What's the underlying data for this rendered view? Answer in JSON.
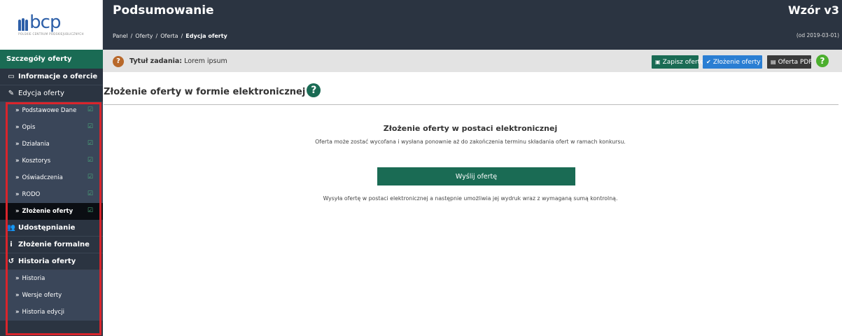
{
  "logo": {
    "word": "bcp",
    "sub": "POLSKIE CENTRUM PODSKIEJUBLICZNYCH"
  },
  "header": {
    "title": "Podsumowanie",
    "breadcrumb": [
      "Panel",
      "Oferty",
      "Oferta",
      "Edycja oferty"
    ],
    "template_title": "Wzór v3",
    "template_date": "(od 2019-03-01)"
  },
  "sidebar": {
    "heading": "Szczegóły oferty",
    "items": [
      {
        "label": "Informacje o ofercie",
        "icon": "monitor-icon"
      },
      {
        "label": "Edycja oferty",
        "icon": "pencil-icon"
      }
    ],
    "sub_items": [
      {
        "label": "Podstawowe Dane",
        "checked": true
      },
      {
        "label": "Opis",
        "checked": true
      },
      {
        "label": "Działania",
        "checked": true
      },
      {
        "label": "Kosztorys",
        "checked": true
      },
      {
        "label": "Oświadczenia",
        "checked": true
      },
      {
        "label": "RODO",
        "checked": true
      },
      {
        "label": "Złożenie oferty",
        "checked": true,
        "active": true
      }
    ],
    "items2": [
      {
        "label": "Udostępnianie",
        "icon": "users-icon"
      },
      {
        "label": "Złożenie formalne",
        "icon": "info-icon"
      },
      {
        "label": "Historia oferty",
        "icon": "history-icon"
      }
    ],
    "history_sub": [
      {
        "label": "Historia"
      },
      {
        "label": "Wersje oferty"
      },
      {
        "label": "Historia edycji"
      }
    ]
  },
  "subbar": {
    "task_label": "Tytuł zadania:",
    "task_value": "Lorem ipsum",
    "save_label": "Zapisz ofertę",
    "submit_label": "Złożenie oferty",
    "pdf_label": "Oferta PDF"
  },
  "main": {
    "heading": "Złożenie oferty w formie elektronicznej",
    "section_title": "Złożenie oferty w postaci elektronicznej",
    "section_desc": "Oferta może zostać wycofana i wysłana ponownie aż do zakończenia terminu składania ofert w ramach konkursu.",
    "send_label": "Wyślij ofertę",
    "send_desc": "Wysyła ofertę w postaci elektronicznej a następnie umożliwia jej wydruk wraz z wymaganą sumą kontrolną."
  },
  "colors": {
    "accent_green": "#1a6b54",
    "sidebar_bg": "#2b3441",
    "highlight_red": "#d9242b",
    "submit_blue": "#2a7ed3"
  }
}
